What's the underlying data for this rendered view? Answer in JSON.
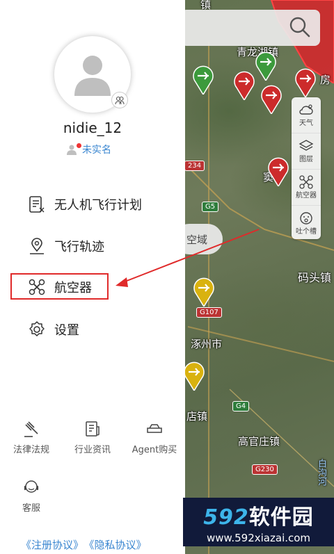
{
  "map": {
    "search_icon": "search-icon",
    "labels": {
      "zhen_top": "镇",
      "qinglong": "青龙湖镇",
      "fang": "房",
      "dou": "窦",
      "matou": "码头镇",
      "zhuozhou": "涿州市",
      "diandian": "店镇",
      "gaoguan": "高官庄镇",
      "baigou": "白沟河"
    },
    "road_badges": [
      "234",
      "G5",
      "G107",
      "G4",
      "G230"
    ],
    "airspace_pill": "空域",
    "tools": [
      {
        "label": "天气",
        "icon": "weather-icon"
      },
      {
        "label": "图层",
        "icon": "layers-icon"
      },
      {
        "label": "航空器",
        "icon": "drone-icon"
      },
      {
        "label": "吐个槽",
        "icon": "feedback-icon"
      }
    ],
    "colors": {
      "red_zone": "#d8252a",
      "marker_red": "#cc2b2b",
      "marker_green": "#3c9a3c",
      "marker_yellow": "#d9b20f"
    }
  },
  "drawer": {
    "username": "nidie_12",
    "realname_status": "未实名",
    "menu": [
      {
        "label": "无人机飞行计划",
        "icon": "flight-plan-icon"
      },
      {
        "label": "飞行轨迹",
        "icon": "track-pin-icon"
      },
      {
        "label": "航空器",
        "icon": "drone-icon"
      },
      {
        "label": "设置",
        "icon": "gear-icon"
      }
    ],
    "bottom": [
      {
        "label": "法律法规",
        "icon": "gavel-icon"
      },
      {
        "label": "行业资讯",
        "icon": "news-icon"
      },
      {
        "label": "Agent购买",
        "icon": "purchase-icon"
      },
      {
        "label": "客服",
        "icon": "customer-service-icon"
      }
    ],
    "agreements": {
      "register": "《注册协议》",
      "privacy": "《隐私协议》"
    },
    "accent": "#3a86d0",
    "highlight_color": "#e02a2a"
  },
  "watermark": {
    "brand_num": "592",
    "brand_cn": "软件园",
    "url": "www.592xiazai.com"
  }
}
